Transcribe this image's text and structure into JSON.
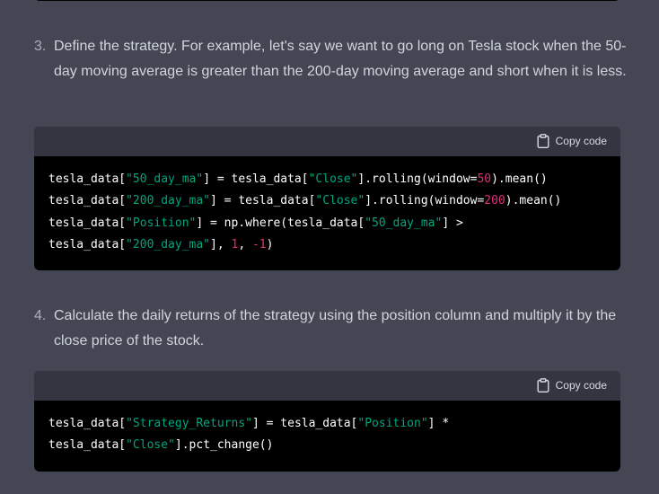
{
  "items": [
    {
      "number": "3.",
      "text": "Define the strategy. For example, let's say we want to go long on Tesla stock when the 50-day moving average is greater than the 200-day moving average and short when it is less."
    },
    {
      "number": "4.",
      "text": "Calculate the daily returns of the strategy using the position column and multiply it by the close price of the stock."
    }
  ],
  "code_blocks": [
    {
      "copy_label": "Copy code",
      "lines": [
        [
          {
            "t": "tesla_data[",
            "c": "plain"
          },
          {
            "t": "\"50_day_ma\"",
            "c": "str"
          },
          {
            "t": "] = tesla_data[",
            "c": "plain"
          },
          {
            "t": "\"Close\"",
            "c": "str"
          },
          {
            "t": "].rolling(window=",
            "c": "plain"
          },
          {
            "t": "50",
            "c": "num-lit"
          },
          {
            "t": ").mean()",
            "c": "plain"
          }
        ],
        [
          {
            "t": "tesla_data[",
            "c": "plain"
          },
          {
            "t": "\"200_day_ma\"",
            "c": "str"
          },
          {
            "t": "] = tesla_data[",
            "c": "plain"
          },
          {
            "t": "\"Close\"",
            "c": "str"
          },
          {
            "t": "].rolling(window=",
            "c": "plain"
          },
          {
            "t": "200",
            "c": "num-lit"
          },
          {
            "t": ").mean()",
            "c": "plain"
          }
        ],
        [
          {
            "t": "tesla_data[",
            "c": "plain"
          },
          {
            "t": "\"Position\"",
            "c": "str"
          },
          {
            "t": "] = np.where(tesla_data[",
            "c": "plain"
          },
          {
            "t": "\"50_day_ma\"",
            "c": "str"
          },
          {
            "t": "] >",
            "c": "plain"
          }
        ],
        [
          {
            "t": "tesla_data[",
            "c": "plain"
          },
          {
            "t": "\"200_day_ma\"",
            "c": "str"
          },
          {
            "t": "], ",
            "c": "plain"
          },
          {
            "t": "1",
            "c": "num-lit"
          },
          {
            "t": ", ",
            "c": "plain"
          },
          {
            "t": "-1",
            "c": "num-lit"
          },
          {
            "t": ")",
            "c": "plain"
          }
        ]
      ]
    },
    {
      "copy_label": "Copy code",
      "lines": [
        [
          {
            "t": "tesla_data[",
            "c": "plain"
          },
          {
            "t": "\"Strategy_Returns\"",
            "c": "str"
          },
          {
            "t": "] = tesla_data[",
            "c": "plain"
          },
          {
            "t": "\"Position\"",
            "c": "str"
          },
          {
            "t": "] *",
            "c": "plain"
          }
        ],
        [
          {
            "t": "tesla_data[",
            "c": "plain"
          },
          {
            "t": "\"Close\"",
            "c": "str"
          },
          {
            "t": "].pct_change()",
            "c": "plain"
          }
        ]
      ]
    }
  ],
  "colors": {
    "background": "#444654",
    "code_header": "#343541",
    "code_body": "#000000",
    "string": "#00a67d",
    "number": "#df3079"
  },
  "icons": {
    "copy": "clipboard-icon"
  }
}
